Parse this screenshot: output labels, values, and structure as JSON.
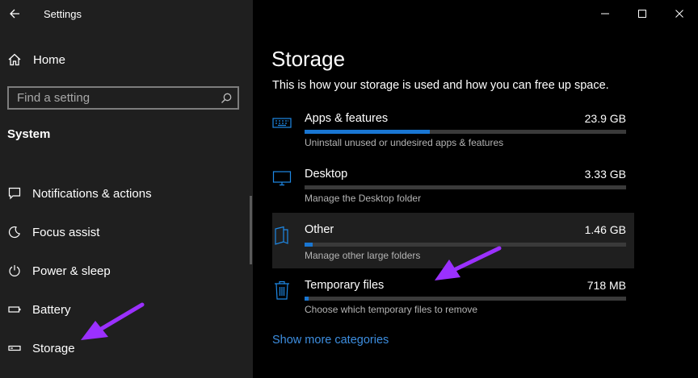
{
  "window": {
    "title": "Settings"
  },
  "sidebar": {
    "home_label": "Home",
    "search_placeholder": "Find a setting",
    "section": "System",
    "items": [
      {
        "label": "Notifications & actions",
        "icon": "message-icon"
      },
      {
        "label": "Focus assist",
        "icon": "moon-icon"
      },
      {
        "label": "Power & sleep",
        "icon": "power-icon"
      },
      {
        "label": "Battery",
        "icon": "battery-icon"
      },
      {
        "label": "Storage",
        "icon": "storage-icon"
      }
    ]
  },
  "main": {
    "title": "Storage",
    "description": "This is how your storage is used and how you can free up space.",
    "categories": [
      {
        "name": "Apps & features",
        "size": "23.9 GB",
        "subtitle": "Uninstall unused or undesired apps & features",
        "usage_fraction": 0.39,
        "icon": "keyboard-icon"
      },
      {
        "name": "Desktop",
        "size": "3.33 GB",
        "subtitle": "Manage the Desktop folder",
        "usage_fraction": 0.0,
        "icon": "monitor-icon"
      },
      {
        "name": "Other",
        "size": "1.46 GB",
        "subtitle": "Manage other large folders",
        "usage_fraction": 0.025,
        "icon": "folder-icon"
      },
      {
        "name": "Temporary files",
        "size": "718 MB",
        "subtitle": "Choose which temporary files to remove",
        "usage_fraction": 0.012,
        "icon": "trash-icon"
      }
    ],
    "show_more": "Show more categories"
  },
  "colors": {
    "accent": "#1976d2",
    "link": "#3d8ee0",
    "annotation_arrow": "#9b30ff",
    "sidebar_bg": "#1f1f1f"
  }
}
